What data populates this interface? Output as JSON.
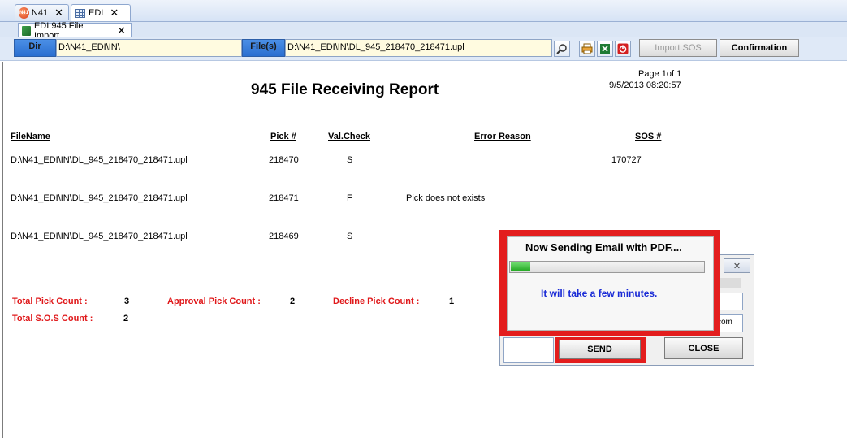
{
  "tabs": [
    {
      "label": "N41",
      "icon": "n41-logo-icon",
      "close": "✕"
    },
    {
      "label": "EDI",
      "icon": "grid-icon",
      "close": "✕"
    }
  ],
  "subtab": {
    "label": "EDI 945 File Import",
    "close": "✕"
  },
  "toolbar": {
    "dir_label": "Dir",
    "dir_value": "D:\\N41_EDI\\IN\\",
    "files_label": "File(s)",
    "files_value": "D:\\N41_EDI\\IN\\DL_945_218470_218471.upl",
    "import_sos_label": "Import SOS",
    "confirmation_label": "Confirmation"
  },
  "report": {
    "title": "945 File Receiving Report",
    "page": "Page 1of 1",
    "datetime": "9/5/2013 08:20:57",
    "headers": {
      "filename": "FileName",
      "pick": "Pick #",
      "valcheck": "Val.Check",
      "error": "Error Reason",
      "sos": "SOS #"
    },
    "rows": [
      {
        "filename": "D:\\N41_EDI\\IN\\DL_945_218470_218471.upl",
        "pick": "218470",
        "valcheck": "S",
        "error": "",
        "sos": "170727"
      },
      {
        "filename": "D:\\N41_EDI\\IN\\DL_945_218470_218471.upl",
        "pick": "218471",
        "valcheck": "F",
        "error": "Pick does not exists",
        "sos": ""
      },
      {
        "filename": "D:\\N41_EDI\\IN\\DL_945_218470_218471.upl",
        "pick": "218469",
        "valcheck": "S",
        "error": "",
        "sos": ""
      }
    ],
    "totals": {
      "total_pick_label": "Total Pick Count :",
      "total_pick_value": "3",
      "approval_label": "Approval Pick Count :",
      "approval_value": "2",
      "decline_label": "Decline Pick Count :",
      "decline_value": "1",
      "total_sos_label": "Total S.O.S Count :",
      "total_sos_value": "2"
    }
  },
  "dialog": {
    "close_icon": "✕",
    "email_fragment": "com",
    "send_label": "SEND",
    "close_label": "CLOSE"
  },
  "popup": {
    "title": "Now Sending Email with PDF....",
    "message": "It will take a few minutes.",
    "progress_fraction": 0.1
  },
  "colors": {
    "accent_red": "#e31d1d",
    "label_blue": "#2a6fd0",
    "message_blue": "#1a2bd6"
  }
}
